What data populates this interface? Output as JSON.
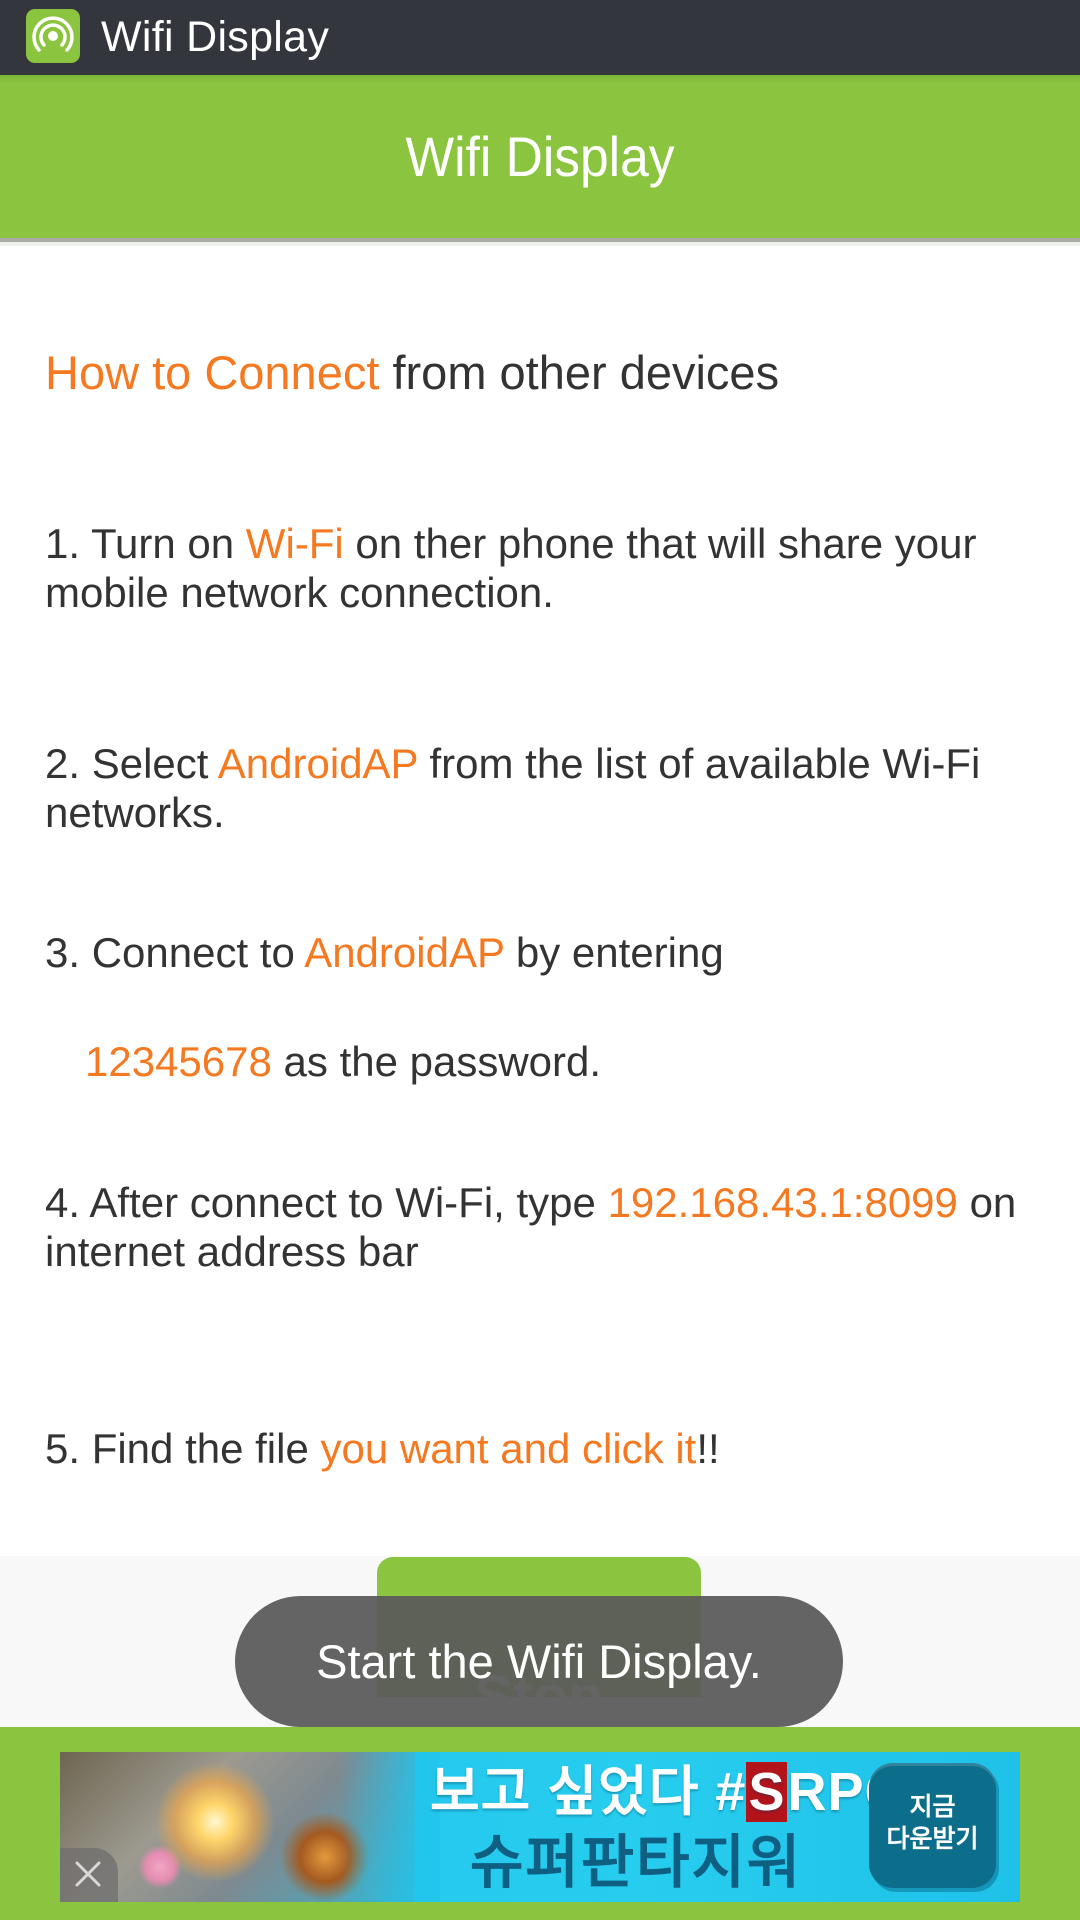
{
  "app": {
    "window_title": "Wifi Display",
    "icon": "wifi-signal-icon"
  },
  "header": {
    "title": "Wifi Display"
  },
  "colors": {
    "accent_green": "#8bc53f",
    "highlight_orange": "#f47920",
    "title_bar": "#33363d",
    "body_text": "#333333"
  },
  "content": {
    "heading": {
      "highlight": "How to Connect",
      "rest": " from other devices"
    },
    "steps": [
      {
        "line1_pre": "1. Turn on ",
        "line1_hl": "Wi-Fi",
        "line1_post": " on ther phone that will share your",
        "line2": "mobile network connection."
      },
      {
        "line1_pre": "2. Select ",
        "line1_hl": "AndroidAP",
        "line1_post": " from the list of available Wi-Fi",
        "line2": "networks."
      },
      {
        "line1_pre": "3. Connect to ",
        "line1_hl": "AndroidAP",
        "line1_post": " by entering",
        "line2_hl": "12345678",
        "line2_post": " as the password."
      },
      {
        "line1_pre": "4. After connect to Wi-Fi, type ",
        "line1_hl": "192.168.43.1:8099",
        "line1_post": " on",
        "line2": "internet address bar"
      },
      {
        "line1_pre": "5. Find the file ",
        "line1_hl": "you want and click it",
        "line1_post": "!!"
      }
    ]
  },
  "controls": {
    "stop_button_label": "Stop"
  },
  "toast": {
    "message": "Start the Wifi Display."
  },
  "ad": {
    "line1_pre": "보고 싶었다 #",
    "line1_s": "S",
    "line1_post": "RPG",
    "line2": "슈퍼판타지워",
    "cta_line1": "지금",
    "cta_line2": "다운받기",
    "close_icon": "close-icon"
  }
}
